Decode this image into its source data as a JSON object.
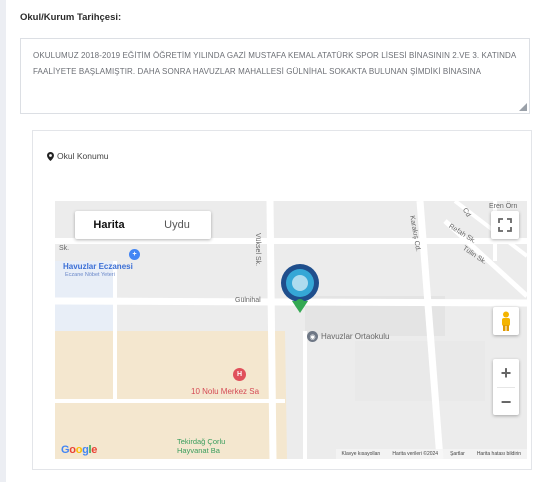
{
  "history": {
    "title": "Okul/Kurum Tarihçesi:",
    "text": "OKULUMUZ 2018-2019 EĞİTİM ÖĞRETİM YILINDA GAZİ MUSTAFA KEMAL ATATÜRK SPOR LİSESİ BİNASININ 2.VE 3. KATINDA FAALİYETE BAŞLAMIŞTIR. DAHA SONRA HAVUZLAR MAHALLESİ GÜLNİHAL SOKAKTA BULUNAN ŞİMDİKİ BİNASINA"
  },
  "location": {
    "label": "Okul Konumu"
  },
  "map": {
    "toggle": {
      "map_label": "Harita",
      "satellite_label": "Uydu"
    },
    "streets": {
      "vuksel": "Vüksel Sk.",
      "karakis": "Karakış Cd.",
      "refah": "Refah Sk.",
      "tulin": "Tülin Sk.",
      "gulnihal": "Gülnihal",
      "sk": "Sk.",
      "cd": "Cd",
      "eren": "Eren Örn"
    },
    "pois": {
      "pharmacy": "Havuzlar Eczanesi",
      "pharmacy_sub": "Eczane Nöbet Yeteri",
      "school": "Havuzlar Ortaokulu",
      "health": "10 Nolu Merkez Sa",
      "vet_line1": "Tekirdağ Çorlu",
      "vet_line2": "Hayvanat Ba"
    },
    "zoom_in": "+",
    "zoom_out": "−",
    "attribution": {
      "shortcuts": "Klavye kısayolları",
      "data": "Harita verileri ©2024",
      "terms": "Şartlar",
      "report": "Harita hatası bildirin"
    },
    "google": [
      "G",
      "o",
      "o",
      "g",
      "l",
      "e"
    ],
    "google_colors": [
      "#4285F4",
      "#EA4335",
      "#FBBC05",
      "#4285F4",
      "#34A853",
      "#EA4335"
    ]
  }
}
